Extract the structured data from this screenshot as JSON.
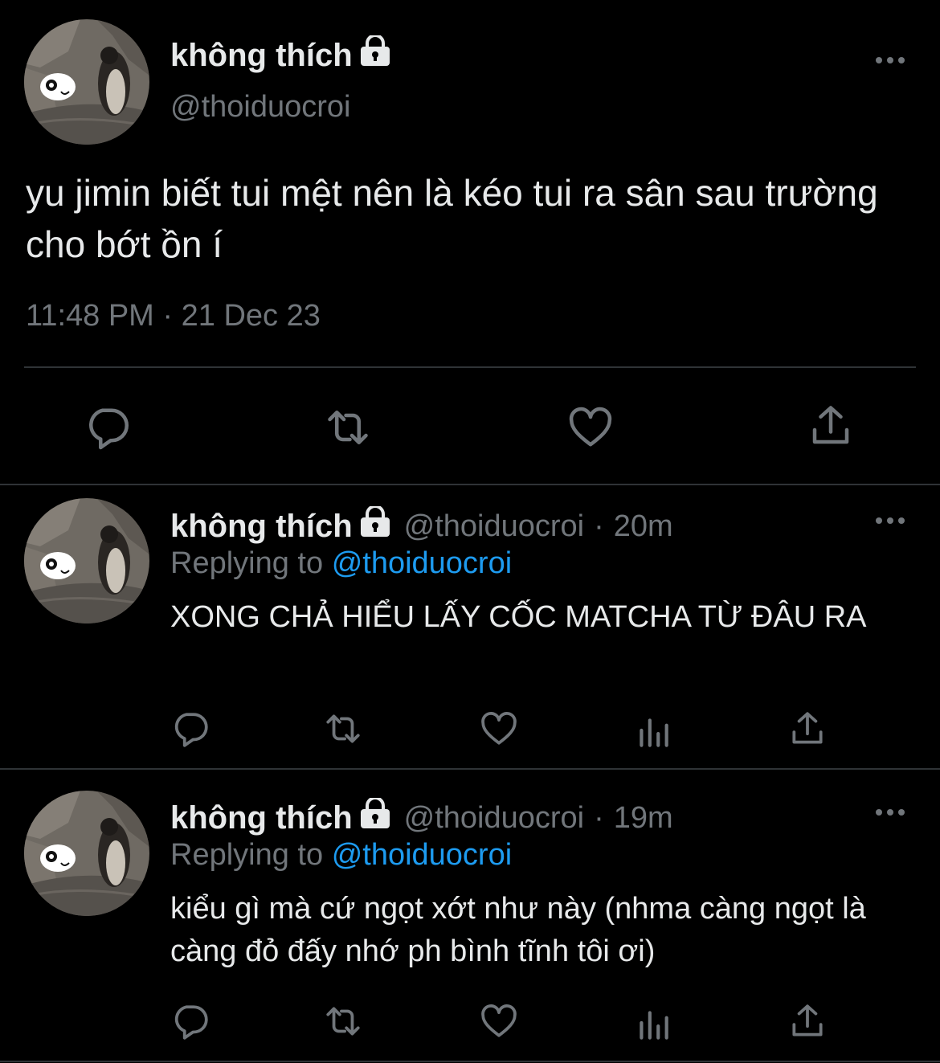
{
  "main_tweet": {
    "display_name": "không thích",
    "handle": "@thoiduocroi",
    "text": "yu jimin biết tui mệt nên là kéo tui ra sân sau trường cho bớt ồn í",
    "time": "11:48 PM",
    "separator": "·",
    "date": "21 Dec 23"
  },
  "replies": [
    {
      "display_name": "không thích",
      "handle": "@thoiduocroi",
      "separator": "·",
      "age": "20m",
      "replying_prefix": "Replying to",
      "replying_to": "@thoiduocroi",
      "text": "XONG CHẢ HIỂU LẤY CỐC MATCHA TỪ ĐÂU RA"
    },
    {
      "display_name": "không thích",
      "handle": "@thoiduocroi",
      "separator": "·",
      "age": "19m",
      "replying_prefix": "Replying to",
      "replying_to": "@thoiduocroi",
      "text": "kiểu gì mà cứ ngọt xớt như này (nhma càng ngọt là càng đỏ đấy nhớ ph bình tĩnh tôi ơi)"
    }
  ],
  "icons": {
    "lock": "lock-icon",
    "more": "more-horizontal-icon",
    "reply": "reply-icon",
    "retweet": "retweet-icon",
    "like": "heart-icon",
    "views": "views-chart-icon",
    "share": "share-icon"
  },
  "colors": {
    "background": "#000000",
    "text": "#e7e9ea",
    "secondary": "#71767b",
    "link": "#1d9bf0",
    "divider": "#2f3336"
  }
}
